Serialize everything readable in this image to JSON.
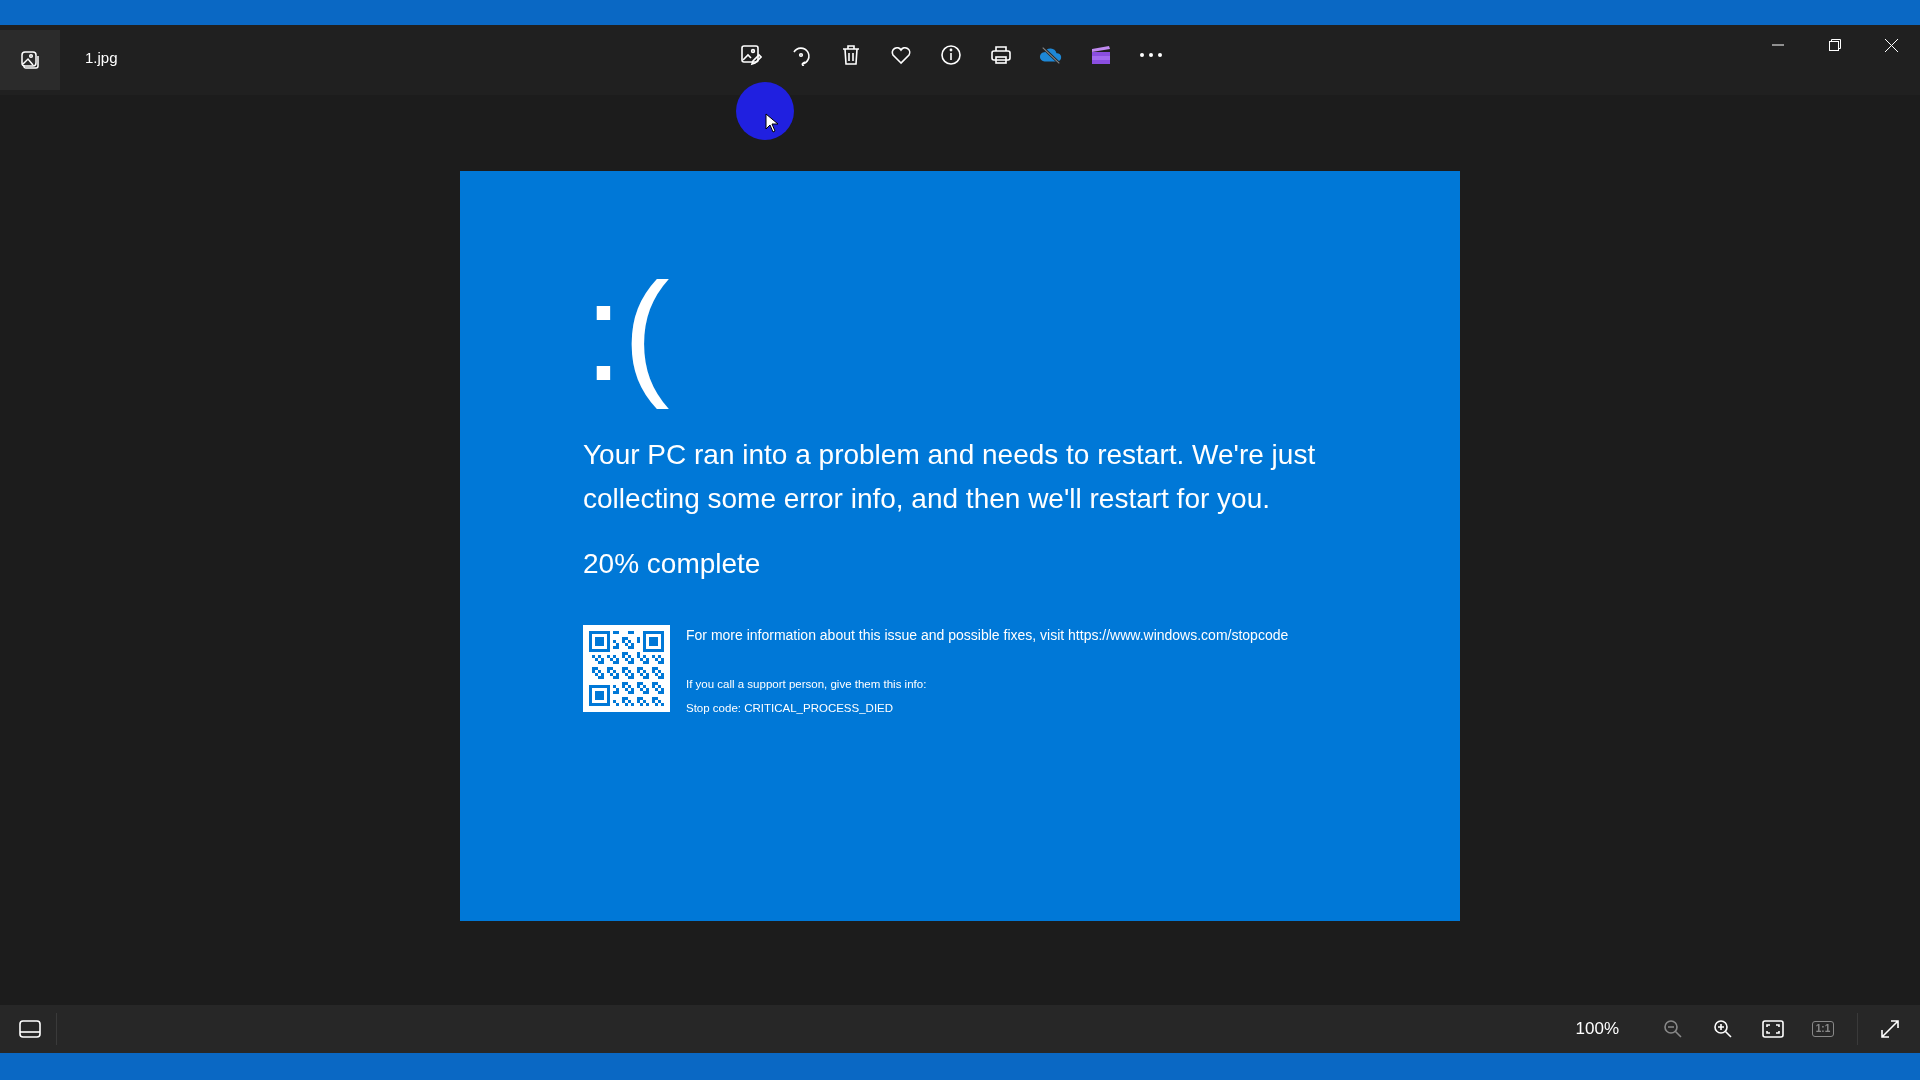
{
  "window": {
    "title": "1.jpg"
  },
  "image": {
    "frown": ":(",
    "message": "Your PC ran into a problem and needs to restart. We're just collecting some error info, and then we'll restart for you.",
    "progress": "20% complete",
    "info": "For more information about this issue and possible fixes, visit https://www.windows.com/stopcode",
    "support": "If you call a support person, give them this info:",
    "stop_code": "Stop code: CRITICAL_PROCESS_DIED"
  },
  "zoom": {
    "value": "100%"
  },
  "view_tools": [
    {
      "kind": "zoom-out",
      "disabled": true
    },
    {
      "kind": "zoom-in",
      "disabled": false
    },
    {
      "kind": "fit",
      "disabled": false
    },
    {
      "kind": "actual-size",
      "label": "1:1",
      "disabled": true
    }
  ]
}
